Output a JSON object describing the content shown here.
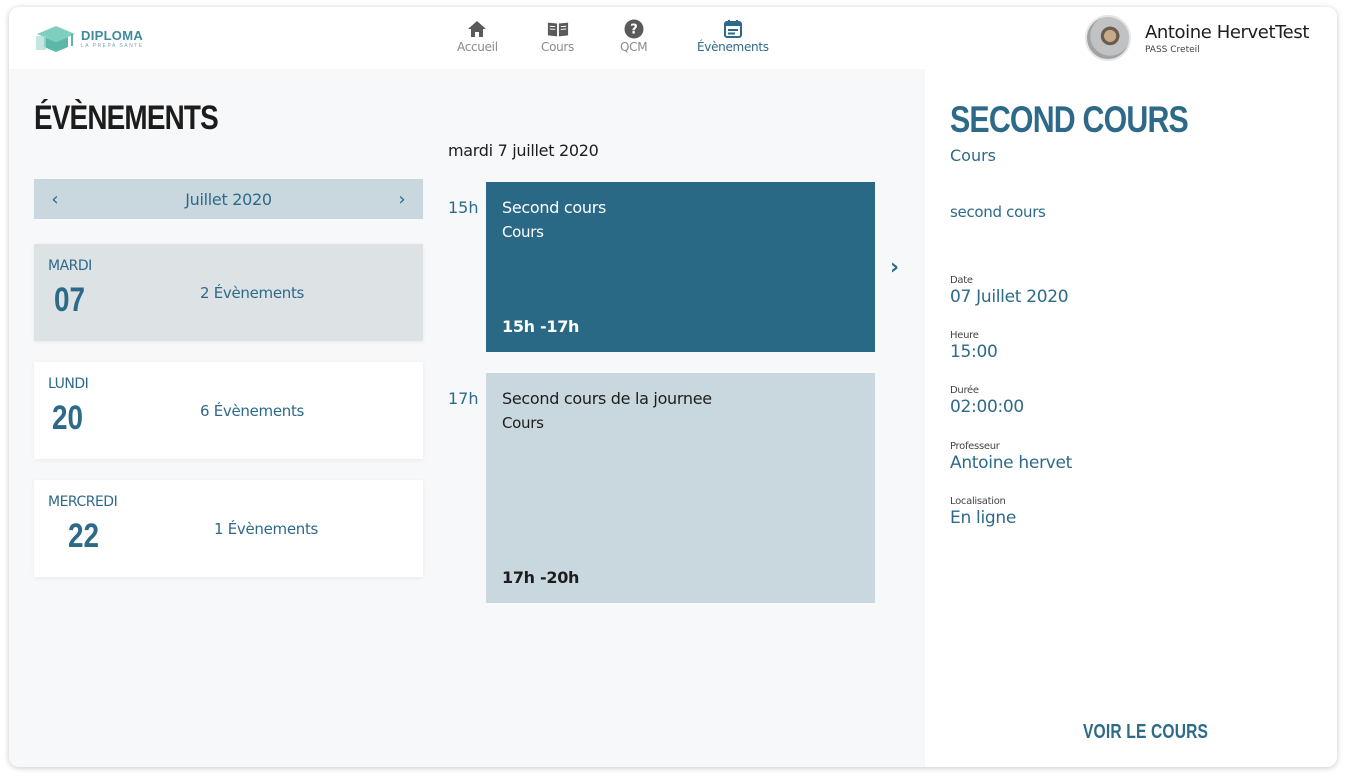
{
  "brand": {
    "name": "DIPLOMA",
    "tagline": "LA PREPA SANTE"
  },
  "nav": [
    {
      "label": "Accueil",
      "icon": "home-icon"
    },
    {
      "label": "Cours",
      "icon": "book-icon"
    },
    {
      "label": "QCM",
      "icon": "question-icon"
    },
    {
      "label": "Évènements",
      "icon": "calendar-icon",
      "active": true
    }
  ],
  "user": {
    "name": "Antoine HervetTest",
    "subtitle": "PASS Creteil"
  },
  "page": {
    "title": "ÉVÈNEMENTS"
  },
  "calendar": {
    "month_label": "Juillet 2020",
    "days": [
      {
        "dow": "MARDI",
        "num": "07",
        "count": "2 Évènements",
        "selected": true
      },
      {
        "dow": "LUNDI",
        "num": "20",
        "count": "6 Évènements"
      },
      {
        "dow": "MERCREDI",
        "num": "22",
        "count": "1 Évènements"
      }
    ]
  },
  "schedule": {
    "date": "mardi 7 juillet 2020",
    "events": [
      {
        "hour": "15h",
        "title": "Second cours",
        "type": "Cours",
        "time": "15h -17h"
      },
      {
        "hour": "17h",
        "title": "Second cours de la journee",
        "type": "Cours",
        "time": "17h -20h"
      }
    ]
  },
  "detail": {
    "title": "SECOND COURS",
    "type": "Cours",
    "description": "second cours",
    "fields": [
      {
        "label": "Date",
        "value": "07 Juillet 2020"
      },
      {
        "label": "Heure",
        "value": "15:00"
      },
      {
        "label": "Durée",
        "value": "02:00:00"
      },
      {
        "label": "Professeur",
        "value": "Antoine hervet"
      },
      {
        "label": "Localisation",
        "value": "En ligne"
      }
    ],
    "action_label": "VOIR LE COURS"
  },
  "colors": {
    "accent": "#2d6a8a",
    "event_active": "#2a6986",
    "event_light": "#c9d7de",
    "selected_day": "#dde2e5"
  }
}
